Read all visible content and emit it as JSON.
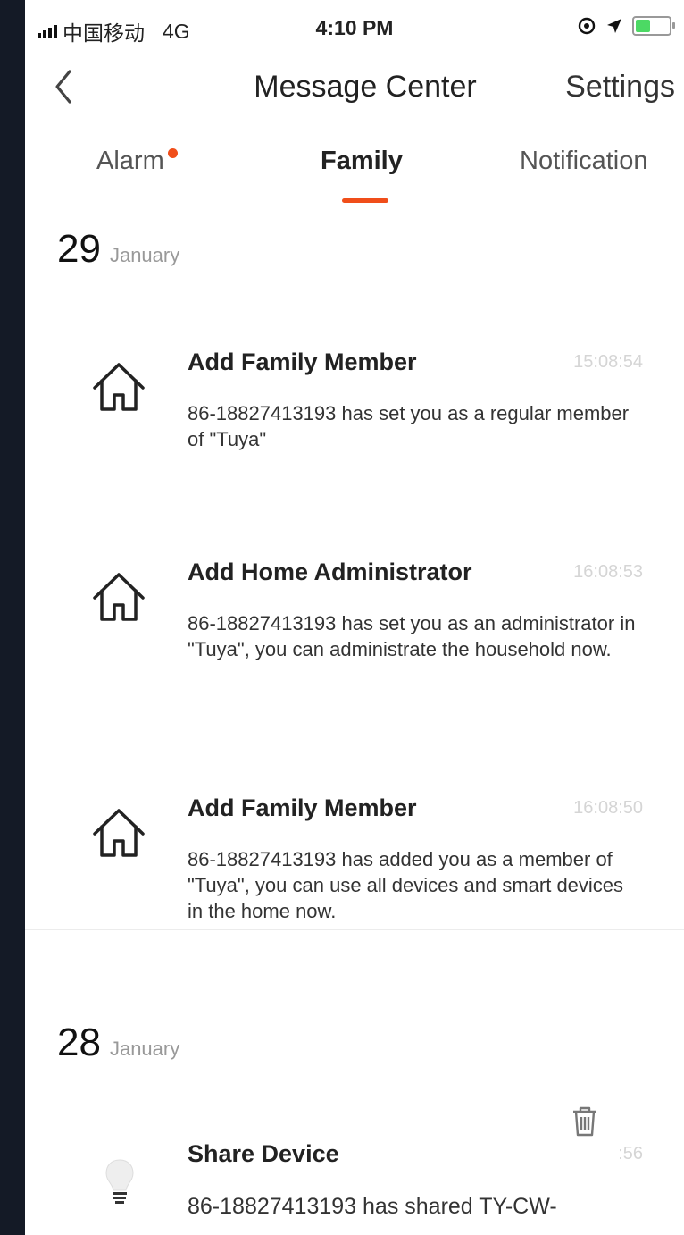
{
  "status_bar": {
    "carrier": "中国移动",
    "network": "4G",
    "time": "4:10 PM"
  },
  "nav": {
    "title": "Message Center",
    "settings_label": "Settings"
  },
  "tabs": [
    {
      "label": "Alarm",
      "has_dot": true
    },
    {
      "label": "Family",
      "active": true
    },
    {
      "label": "Notification"
    }
  ],
  "groups": [
    {
      "day": "29",
      "month": "January",
      "messages": [
        {
          "title": "Add Family Member",
          "time": "15:08:54",
          "body": "86-18827413193 has set you as a regular member of \"Tuya\""
        },
        {
          "title": "Add Home Administrator",
          "time": "16:08:53",
          "body": "86-18827413193 has set you as an administrator in \"Tuya\", you can administrate the household now."
        },
        {
          "title": "Add Family Member",
          "time": "16:08:50",
          "body": "86-18827413193 has added you as a member of \"Tuya\", you can use all devices and smart devices in the home now."
        }
      ]
    },
    {
      "day": "28",
      "month": "January",
      "messages": [
        {
          "title": "Share Device",
          "time": ":56",
          "body": "86-18827413193 has shared TY-CW-"
        }
      ]
    }
  ],
  "colors": {
    "accent": "#f04e1a",
    "background_outer": "#141a26"
  }
}
